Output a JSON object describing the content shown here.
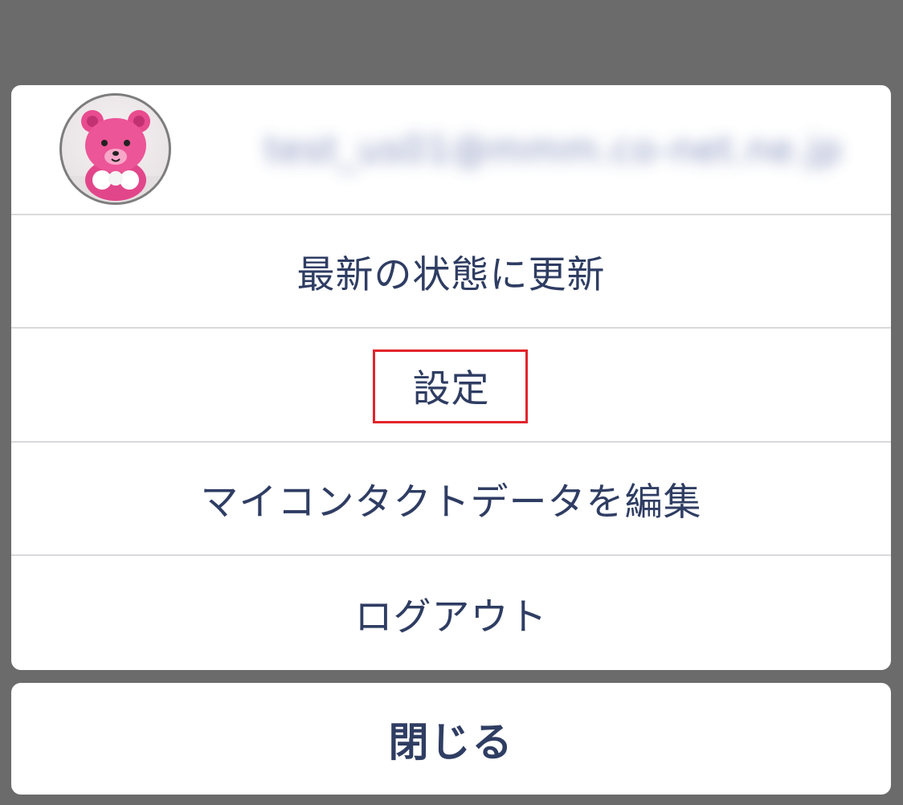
{
  "account": {
    "email": "test_us01@mmm.co-net.ne.jp",
    "avatar_icon": "teddy-bear-avatar"
  },
  "menu": {
    "items": [
      {
        "label": "最新の状態に更新"
      },
      {
        "label": "設定"
      },
      {
        "label": "マイコンタクトデータを編集"
      },
      {
        "label": "ログアウト"
      }
    ]
  },
  "close_label": "閉じる",
  "colors": {
    "backdrop": "#6b6b6b",
    "text": "#2f3d63",
    "highlight": "#e3242b",
    "divider": "#d9d9dd"
  }
}
